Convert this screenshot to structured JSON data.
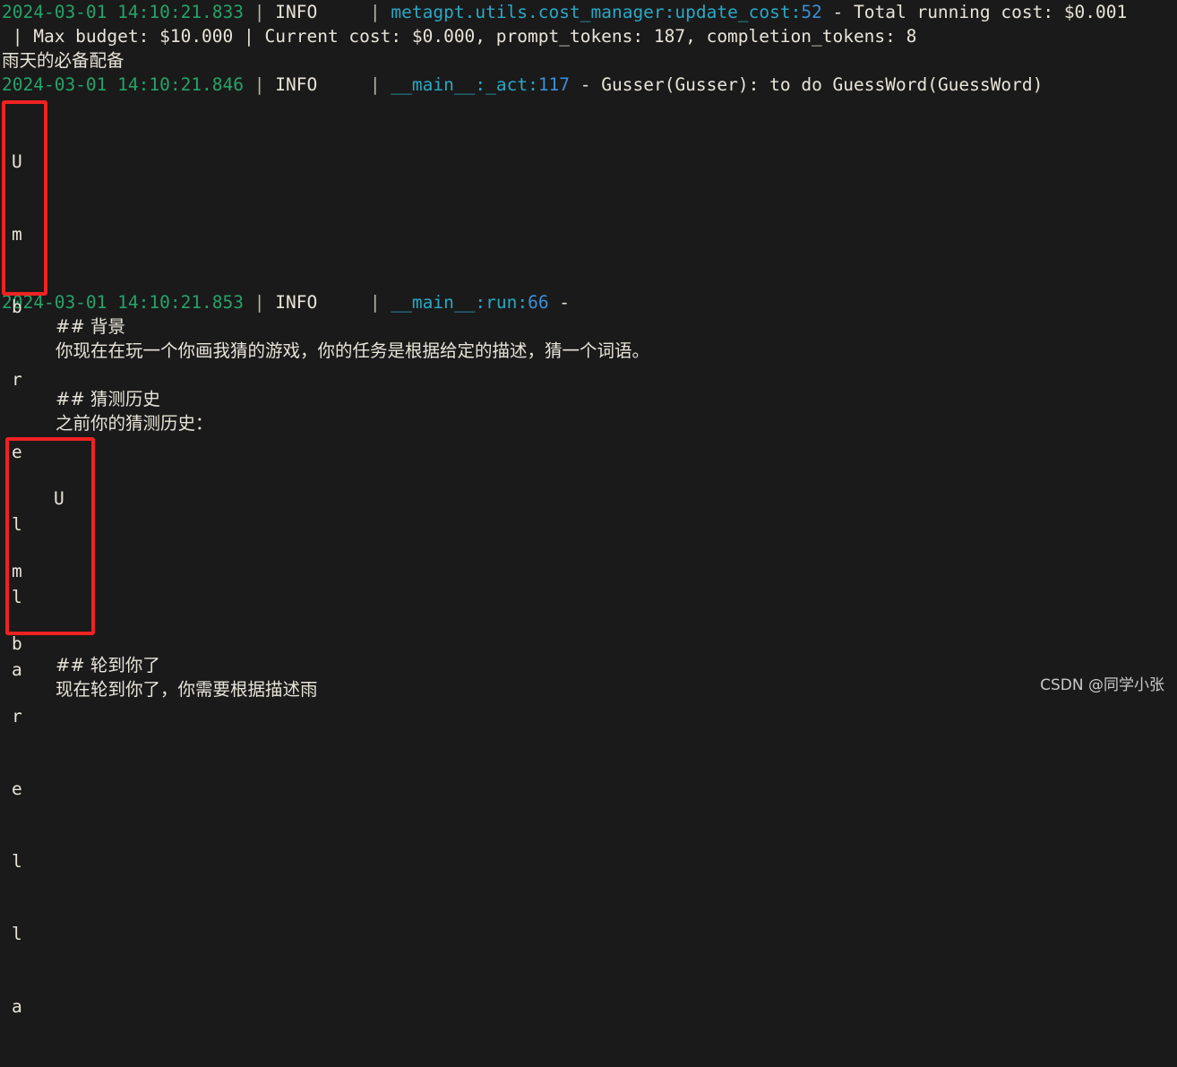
{
  "terminal": {
    "background_color": "#1a1a1a",
    "default_text_color": "#e8e4d9",
    "colors": {
      "timestamp_green": "#26a269",
      "module_cyan": "#2aa8c4",
      "lineno_blue": "#3b8fd6",
      "annotation_red": "#f02222"
    },
    "lines": {
      "l1_timestamp": "2024-03-01 14:10:21.833",
      "l1_sep1": " | ",
      "l1_level": "INFO",
      "l1_pad": "     | ",
      "l1_module": "metagpt.utils.cost_manager",
      "l1_colon1": ":",
      "l1_func": "update_cost",
      "l1_colon2": ":",
      "l1_lineno": "52",
      "l1_msg": " - Total running cost: $0.001",
      "l2_msg": " | Max budget: $10.000 | Current cost: $0.000, prompt_tokens: 187, completion_tokens: 8",
      "l3_cjk": "雨天的必备配备",
      "l4_timestamp": "2024-03-01 14:10:21.846",
      "l4_sep1": " | ",
      "l4_level": "INFO",
      "l4_pad": "     | ",
      "l4_module": "__main__",
      "l4_colon1": ":",
      "l4_func": "_act",
      "l4_colon2": ":",
      "l4_lineno": "117",
      "l4_msg": " - Gusser(Gusser): to do GuessWord(GuessWord)",
      "l5_timestamp": "2024-03-01 14:10:21.853",
      "l5_sep1": " | ",
      "l5_level": "INFO",
      "l5_pad": "     | ",
      "l5_module": "__main__",
      "l5_colon1": ":",
      "l5_func": "run",
      "l5_colon2": ":",
      "l5_lineno": "66",
      "l5_msg": " - ",
      "heading_background": "## 背景",
      "body_background": "你现在在玩一个你画我猜的游戏，你的任务是根据给定的描述，猜一个词语。",
      "heading_history": "## 猜测历史",
      "body_history": "之前你的猜测历史：",
      "heading_your_turn": "## 轮到你了",
      "body_your_turn": "现在轮到你了，你需要根据描述雨"
    }
  },
  "annotations": {
    "box1": {
      "label": "umbrella-vertical-stack-1",
      "letters": [
        "U",
        "m",
        "b",
        "r",
        "e",
        "l",
        "l",
        "a"
      ]
    },
    "box2": {
      "label": "umbrella-vertical-stack-2",
      "letters": [
        "    U",
        "m",
        "b",
        "r",
        "e",
        "l",
        "l",
        "a"
      ]
    }
  },
  "watermark": {
    "text": "CSDN @同学小张"
  }
}
